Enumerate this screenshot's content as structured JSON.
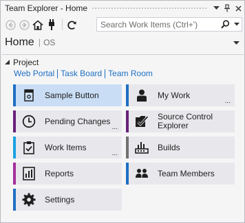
{
  "window": {
    "title": "Team Explorer - Home",
    "buttons": [
      "dropdown-icon",
      "pin-icon",
      "close-icon"
    ]
  },
  "toolbar": {
    "buttons": [
      "back-icon",
      "forward-icon",
      "home-icon",
      "connect-icon",
      "refresh-icon"
    ],
    "search_placeholder": "Search Work Items (Ctrl+')"
  },
  "header": {
    "title": "Home",
    "separator": "|",
    "subtitle": "OS"
  },
  "project": {
    "heading": "Project",
    "links": [
      "Web Portal",
      "Task Board",
      "Team Room"
    ]
  },
  "tiles": [
    {
      "label": "Sample Button",
      "icon": "sample-button-icon",
      "accent": "#1e6fc2",
      "selected": true,
      "more": false
    },
    {
      "label": "My Work",
      "icon": "person-icon",
      "accent": "#1e6fc2",
      "selected": false,
      "more": true,
      "more_text": "..."
    },
    {
      "label": "Pending Changes",
      "icon": "clock-icon",
      "accent": "#68217a",
      "selected": false,
      "more": true,
      "more_text": "..."
    },
    {
      "label": "Source Control Explorer",
      "label_line1": "Source Control",
      "label_line2": "Explorer",
      "icon": "source-control-icon",
      "accent": "#68217a",
      "selected": false,
      "more": false
    },
    {
      "label": "Work Items",
      "icon": "clipboard-check-icon",
      "accent": "#1ba1e2",
      "selected": false,
      "more": true,
      "more_text": "..."
    },
    {
      "label": "Builds",
      "icon": "builds-icon",
      "accent": "#717171",
      "selected": false,
      "more": false
    },
    {
      "label": "Reports",
      "icon": "reports-icon",
      "accent": "#a4309a",
      "selected": false,
      "more": false
    },
    {
      "label": "Team Members",
      "icon": "team-members-icon",
      "accent": "#1e6fc2",
      "selected": false,
      "more": false
    },
    {
      "label": "Settings",
      "icon": "gear-icon",
      "accent": "#1e6fc2",
      "selected": false,
      "more": false
    }
  ]
}
